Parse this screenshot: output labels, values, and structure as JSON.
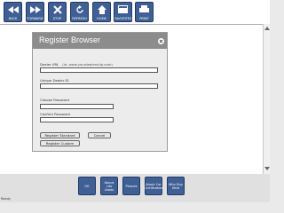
{
  "toolbar": {
    "back": "BACK",
    "forward": "FORWARD",
    "stop": "STOP",
    "refresh": "REFRESH",
    "home": "HOME",
    "favorites": "FAVORITES",
    "print": "PRINT"
  },
  "dialog": {
    "title": "Register Browser",
    "dealer_url_label": "Dealer URL",
    "dealer_url_hint": "(ie. www.yourdealership.com)",
    "dealer_url_value": "",
    "dealer_id_label": "Unique Dealer ID",
    "dealer_id_value": "",
    "password_label": "Choose Password",
    "password_value": "",
    "confirm_label": "Confirm Password",
    "confirm_value": "",
    "register_standard": "Register Standard",
    "cancel": "Cancel",
    "register_custom": "Register Custom"
  },
  "bottombar": {
    "b1": [
      "OK"
    ],
    "b2": [
      "About Lite",
      "Leads"
    ],
    "b3": [
      "Phones"
    ],
    "b4": [
      "About Car",
      "Certification"
    ],
    "b5": [
      "Why Buy",
      "Here"
    ]
  },
  "status": "Ready"
}
